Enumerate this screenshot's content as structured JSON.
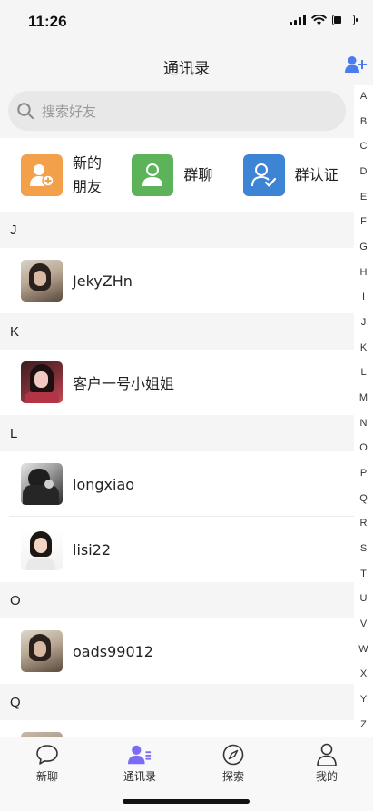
{
  "status_bar": {
    "time": "11:26"
  },
  "header": {
    "title": "通讯录"
  },
  "search": {
    "placeholder": "搜索好友"
  },
  "quick_actions": [
    {
      "label": "新的朋友",
      "color": "#f3a04b",
      "icon": "add-person-icon"
    },
    {
      "label": "群聊",
      "color": "#5cb35a",
      "icon": "person-icon"
    },
    {
      "label": "群认证",
      "color": "#3d85d4",
      "icon": "person-check-icon"
    }
  ],
  "sections": [
    {
      "letter": "J",
      "contacts": [
        {
          "name": "JekyZHn"
        }
      ]
    },
    {
      "letter": "K",
      "contacts": [
        {
          "name": "客户一号小姐姐"
        }
      ]
    },
    {
      "letter": "L",
      "contacts": [
        {
          "name": "longxiao"
        },
        {
          "name": "lisi22"
        }
      ]
    },
    {
      "letter": "O",
      "contacts": [
        {
          "name": "oads99012"
        }
      ]
    },
    {
      "letter": "Q",
      "contacts": []
    }
  ],
  "alphabet": [
    "A",
    "B",
    "C",
    "D",
    "E",
    "F",
    "G",
    "H",
    "I",
    "J",
    "K",
    "L",
    "M",
    "N",
    "O",
    "P",
    "Q",
    "R",
    "S",
    "T",
    "U",
    "V",
    "W",
    "X",
    "Y",
    "Z"
  ],
  "tabs": [
    {
      "label": "新聊",
      "icon": "chat-bubble-icon",
      "active": false
    },
    {
      "label": "通讯录",
      "icon": "contacts-icon",
      "active": true
    },
    {
      "label": "探索",
      "icon": "compass-icon",
      "active": false
    },
    {
      "label": "我的",
      "icon": "profile-icon",
      "active": false
    }
  ],
  "colors": {
    "accent": "#7b6cf6",
    "background": "#f5f5f5"
  }
}
